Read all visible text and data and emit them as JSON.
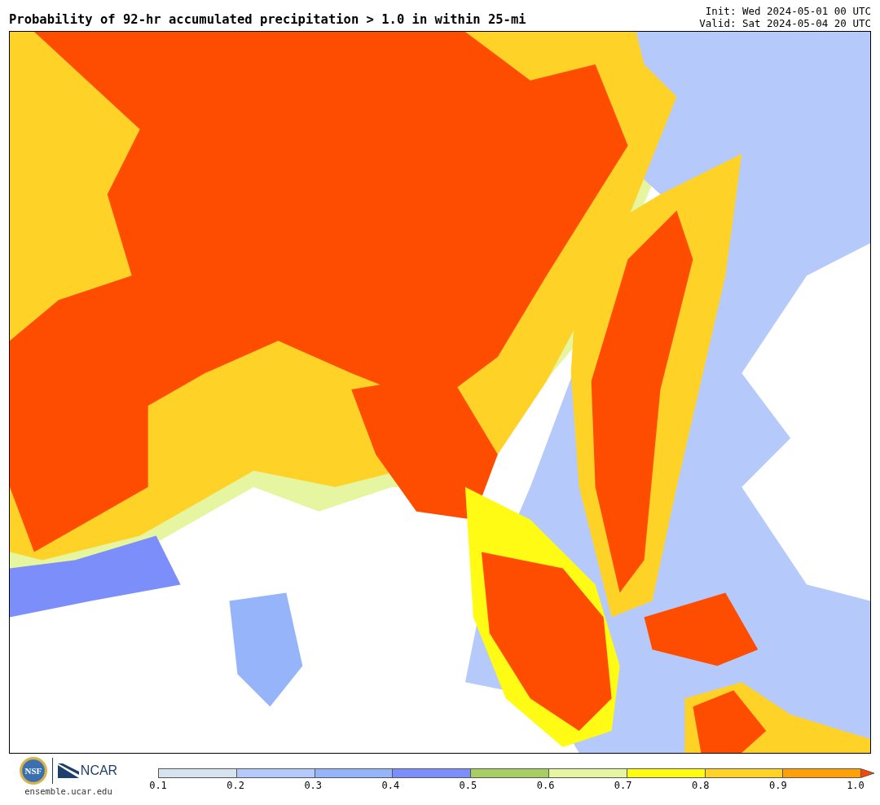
{
  "title": "Probability of 92-hr accumulated precipitation > 1.0 in within 25-mi",
  "init": "Init: Wed 2024-05-01 00 UTC",
  "valid": "Valid: Sat 2024-05-04 20 UTC",
  "logos": {
    "nsf": "NSF",
    "ncar": "NCAR",
    "url": "ensemble.ucar.edu"
  },
  "colorbar": {
    "bins": [
      {
        "color": "#d7e3ee"
      },
      {
        "color": "#b5cafa"
      },
      {
        "color": "#96b4fa"
      },
      {
        "color": "#7c8efa"
      },
      {
        "color": "#a8cd64"
      },
      {
        "color": "#e6f5a0"
      },
      {
        "color": "#fffb14"
      },
      {
        "color": "#ffd228"
      },
      {
        "color": "#ffa00a"
      },
      {
        "color": "#ff4500",
        "kind": "arrow"
      }
    ],
    "ticks": [
      "0.1",
      "0.2",
      "0.3",
      "0.4",
      "0.5",
      "0.6",
      "0.7",
      "0.8",
      "0.9",
      "1.0"
    ]
  }
}
